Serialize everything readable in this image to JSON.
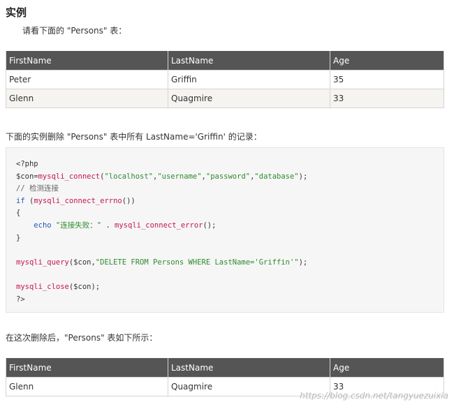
{
  "heading": "实例",
  "intro_text": "请看下面的 \"Persons\" 表：",
  "table_before": {
    "headers": [
      "FirstName",
      "LastName",
      "Age"
    ],
    "rows": [
      [
        "Peter",
        "Griffin",
        "35"
      ],
      [
        "Glenn",
        "Quagmire",
        "33"
      ]
    ]
  },
  "delete_intro": "下面的实例删除 \"Persons\" 表中所有 LastName='Griffin' 的记录：",
  "code": {
    "open_tag": "<?php",
    "con_var": "$con=",
    "connect_fn": "mysqli_connect",
    "paren_open": "(",
    "arg_host": "\"localhost\"",
    "comma": ",",
    "arg_user": "\"username\"",
    "arg_pass": "\"password\"",
    "arg_db": "\"database\"",
    "connect_end": ");",
    "comment": "// 检测连接",
    "if_kw": "if",
    "if_space": " (",
    "errno_fn": "mysqli_connect_errno",
    "if_end": "())",
    "brace_open": "{",
    "indent": "    ",
    "echo_kw": "echo",
    "echo_str": " \"连接失败：\"",
    "concat": " . ",
    "error_fn": "mysqli_connect_error",
    "error_end": "();",
    "brace_close": "}",
    "query_fn": "mysqli_query",
    "query_args_open": "($con,",
    "query_str": "\"DELETE FROM Persons WHERE LastName='Griffin'\"",
    "query_end": ");",
    "close_fn": "mysqli_close",
    "close_args": "($con);",
    "close_tag": "?>"
  },
  "after_text": "在这次删除后，\"Persons\" 表如下所示：",
  "table_after": {
    "headers": [
      "FirstName",
      "LastName",
      "Age"
    ],
    "rows": [
      [
        "Glenn",
        "Quagmire",
        "33"
      ]
    ]
  },
  "watermark": "https://blog.csdn.net/tangyuezuixia"
}
